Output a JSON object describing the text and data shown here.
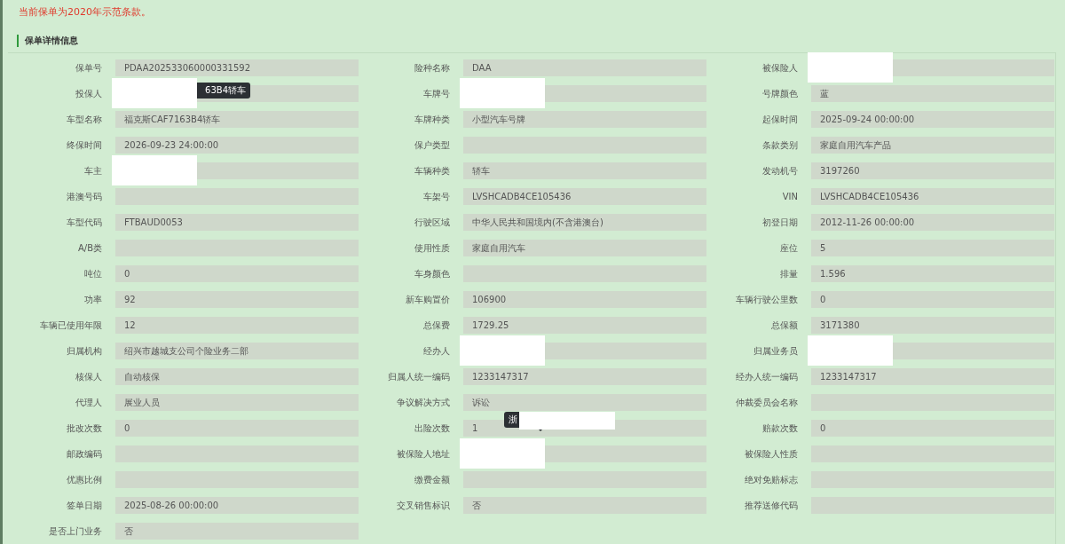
{
  "notice": "当前保单为2020年示范条款。",
  "section": {
    "title": "保单详情信息"
  },
  "fields": [
    {
      "label": "保单号",
      "value": "PDAA202533060000331592"
    },
    {
      "label": "险种名称",
      "value": "DAA"
    },
    {
      "label": "被保险人",
      "redacted": true
    },
    {
      "label": "投保人",
      "redacted": true,
      "tooltip": {
        "text": "63B4轿车",
        "redacted": false
      }
    },
    {
      "label": "车牌号",
      "redacted": true
    },
    {
      "label": "号牌颜色",
      "value": "蓝"
    },
    {
      "label": "车型名称",
      "value": "福克斯CAF7163B4轿车"
    },
    {
      "label": "车牌种类",
      "value": "小型汽车号牌"
    },
    {
      "label": "起保时间",
      "value": "2025-09-24 00:00:00"
    },
    {
      "label": "终保时间",
      "value": "2026-09-23 24:00:00"
    },
    {
      "label": "保户类型"
    },
    {
      "label": "条款类别",
      "value": "家庭自用汽车产品"
    },
    {
      "label": "车主",
      "redacted": true
    },
    {
      "label": "车辆种类",
      "value": "轿车"
    },
    {
      "label": "发动机号",
      "value": "3197260"
    },
    {
      "label": "港澳号码"
    },
    {
      "label": "车架号",
      "value": "LVSHCADB4CE105436"
    },
    {
      "label": "VIN",
      "value": "LVSHCADB4CE105436"
    },
    {
      "label": "车型代码",
      "value": "FTBAUD0053"
    },
    {
      "label": "行驶区域",
      "value": "中华人民共和国境内(不含港澳台)"
    },
    {
      "label": "初登日期",
      "value": "2012-11-26 00:00:00"
    },
    {
      "label": "A/B类"
    },
    {
      "label": "使用性质",
      "value": "家庭自用汽车"
    },
    {
      "label": "座位",
      "value": "5"
    },
    {
      "label": "吨位",
      "value": "0"
    },
    {
      "label": "车身颜色"
    },
    {
      "label": "排量",
      "value": "1.596"
    },
    {
      "label": "功率",
      "value": "92"
    },
    {
      "label": "新车购置价",
      "value": "106900"
    },
    {
      "label": "车辆行驶公里数",
      "value": "0"
    },
    {
      "label": "车辆已使用年限",
      "value": "12"
    },
    {
      "label": "总保费",
      "value": "1729.25"
    },
    {
      "label": "总保额",
      "value": "3171380"
    },
    {
      "label": "归属机构",
      "value": "绍兴市越城支公司个险业务二部"
    },
    {
      "label": "经办人",
      "redacted": true
    },
    {
      "label": "归属业务员",
      "redacted": true
    },
    {
      "label": "核保人",
      "value": "自动核保"
    },
    {
      "label": "归属人统一编码",
      "value": "1233147317"
    },
    {
      "label": "经办人统一编码",
      "value": "1233147317"
    },
    {
      "label": "代理人",
      "value": "展业人员"
    },
    {
      "label": "争议解决方式",
      "value": "诉讼"
    },
    {
      "label": "仲裁委员会名称"
    },
    {
      "label": "批改次数",
      "value": "0"
    },
    {
      "label": "出险次数",
      "value": "1",
      "tooltip": {
        "text": "浙",
        "redacted": true
      }
    },
    {
      "label": "赔款次数",
      "value": "0"
    },
    {
      "label": "邮政编码"
    },
    {
      "label": "被保险人地址",
      "redacted": true
    },
    {
      "label": "被保险人性质"
    },
    {
      "label": "优惠比例"
    },
    {
      "label": "缴费金额"
    },
    {
      "label": "绝对免赔标志"
    },
    {
      "label": "签单日期",
      "value": "2025-08-26 00:00:00"
    },
    {
      "label": "交叉销售标识",
      "value": "否"
    },
    {
      "label": "推荐送修代码"
    },
    {
      "label": "是否上门业务",
      "value": "否"
    }
  ]
}
